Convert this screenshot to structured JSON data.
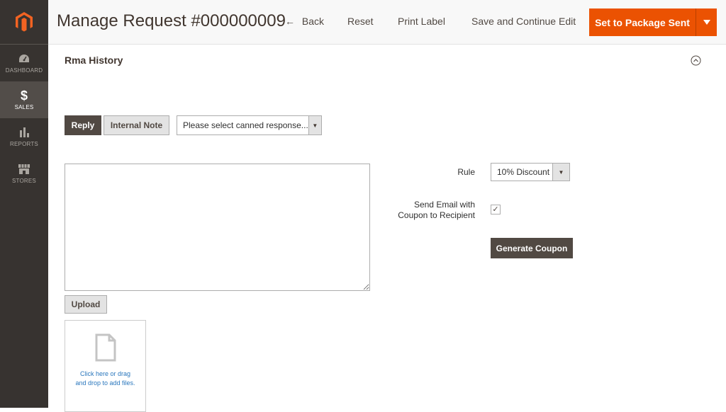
{
  "sidebar": {
    "items": [
      {
        "label": "DASHBOARD",
        "icon": "speedometer-icon"
      },
      {
        "label": "SALES",
        "icon": "dollar-icon"
      },
      {
        "label": "REPORTS",
        "icon": "bar-chart-icon"
      },
      {
        "label": "STORES",
        "icon": "store-icon"
      }
    ]
  },
  "header": {
    "title": "Manage Request #000000009",
    "back_arrow": "←",
    "back_label": "Back",
    "reset_label": "Reset",
    "print_label": "Print Label",
    "save_continue_label": "Save and Continue Edit",
    "primary_label": "Set to Package Sent"
  },
  "section": {
    "title": "Rma History"
  },
  "reply": {
    "tab_reply": "Reply",
    "tab_internal_note": "Internal Note",
    "canned_placeholder": "Please select canned response...",
    "message_value": "",
    "upload_label": "Upload",
    "dropzone_text": "Click here or drag and drop to add files."
  },
  "coupon": {
    "rule_label": "Rule",
    "rule_value": "10% Discount",
    "email_label": "Send Email with Coupon to Recipient",
    "email_checked": true,
    "checkmark": "✓",
    "generate_label": "Generate Coupon"
  },
  "colors": {
    "sidebar_bg": "#373330",
    "primary": "#eb5202",
    "dark_button": "#514943"
  }
}
